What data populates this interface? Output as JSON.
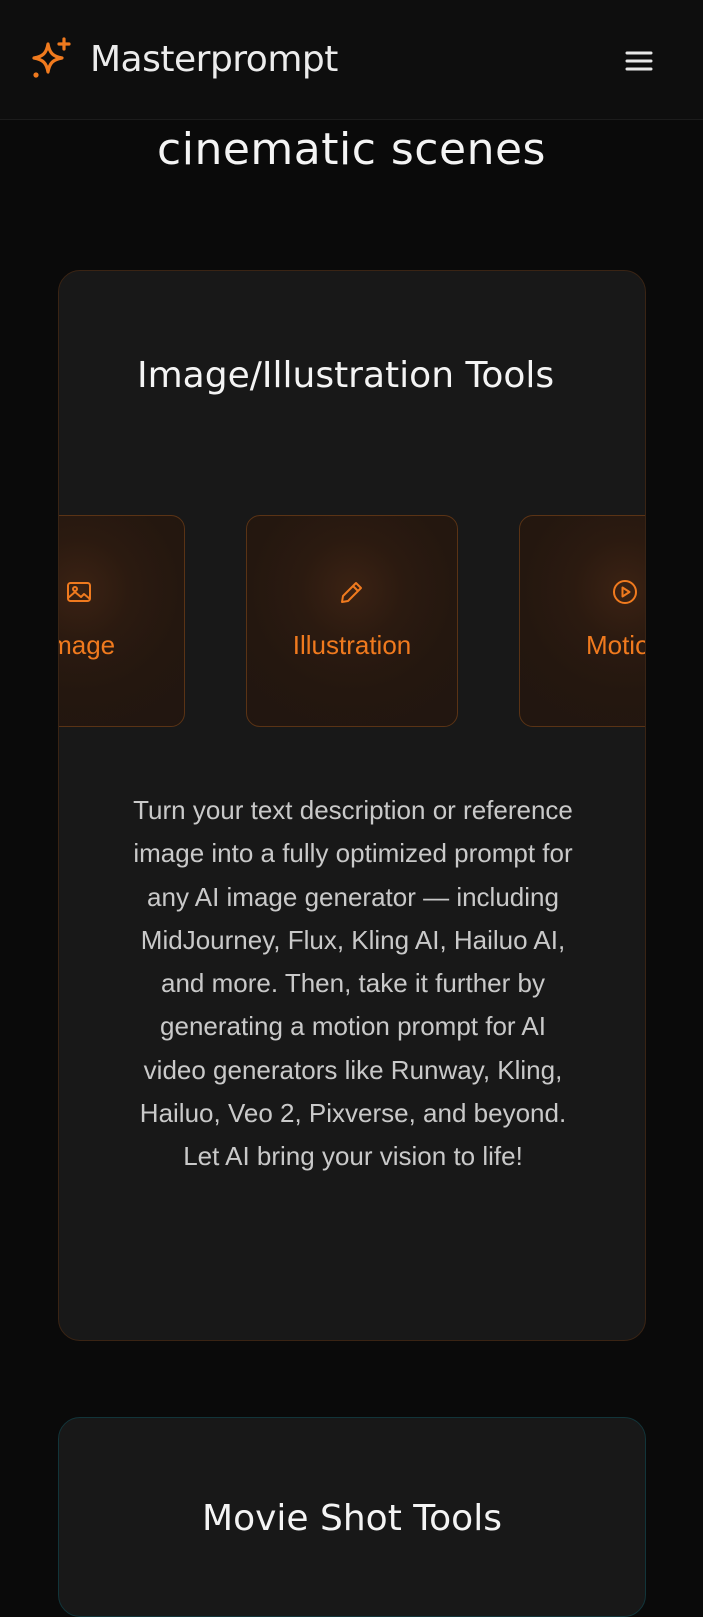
{
  "header": {
    "brand": "Masterprompt",
    "logo_icon": "sparkles-icon",
    "menu_icon": "hamburger-menu-icon",
    "accent_color": "#f07a1e"
  },
  "hero": {
    "title_tail": "cinematic scenes"
  },
  "image_tools": {
    "title": "Image/Illustration Tools",
    "tools": [
      {
        "label": "Image",
        "icon": "image-icon"
      },
      {
        "label": "Illustration",
        "icon": "pencil-icon"
      },
      {
        "label": "Motion",
        "icon": "play-circle-icon"
      }
    ],
    "description": "Turn your text description or reference image into a fully optimized prompt for any AI image generator — including MidJourney, Flux, Kling AI, Hailuo AI, and more. Then, take it further by generating a motion prompt for AI video generators like Runway, Kling, Hailuo, Veo 2, Pixverse, and beyond. Let AI bring your vision to life!"
  },
  "movie_tools": {
    "title": "Movie Shot Tools"
  }
}
